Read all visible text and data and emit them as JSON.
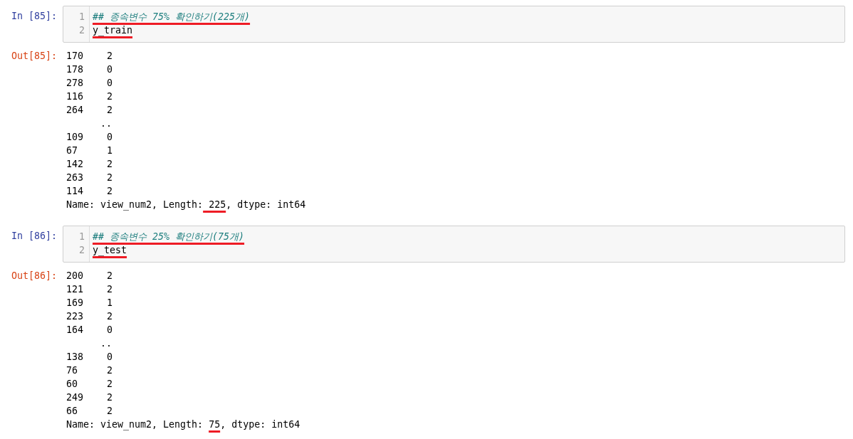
{
  "cells": [
    {
      "prompt_in": "In [85]:",
      "code_lines": [
        {
          "number": "1",
          "kind": "comment",
          "text": "## 종속변수 75% 확인하기(225개)",
          "underlined": true
        },
        {
          "number": "2",
          "kind": "code",
          "text": "y_train",
          "underlined": true
        }
      ],
      "prompt_out": "Out[85]:",
      "output": {
        "rows": [
          {
            "kind": "entry",
            "index": "170",
            "value": "2"
          },
          {
            "kind": "entry",
            "index": "178",
            "value": "0"
          },
          {
            "kind": "entry",
            "index": "278",
            "value": "0"
          },
          {
            "kind": "entry",
            "index": "116",
            "value": "2"
          },
          {
            "kind": "entry",
            "index": "264",
            "value": "2"
          },
          {
            "kind": "ellipsis",
            "value": ".."
          },
          {
            "kind": "entry",
            "index": "109",
            "value": "0"
          },
          {
            "kind": "entry",
            "index": "67",
            "value": "1"
          },
          {
            "kind": "entry",
            "index": "142",
            "value": "2"
          },
          {
            "kind": "entry",
            "index": "263",
            "value": "2"
          },
          {
            "kind": "entry",
            "index": "114",
            "value": "2"
          }
        ],
        "footer": [
          {
            "text": "Name: view_num2, Length:",
            "underlined": false
          },
          {
            "text": " 225",
            "underlined": true
          },
          {
            "text": ", dtype: int64",
            "underlined": false
          }
        ]
      }
    },
    {
      "prompt_in": "In [86]:",
      "code_lines": [
        {
          "number": "1",
          "kind": "comment",
          "text": "## 종속변수 25% 확인하기(75개)",
          "underlined": true
        },
        {
          "number": "2",
          "kind": "code",
          "text": "y_test",
          "underlined": true
        }
      ],
      "prompt_out": "Out[86]:",
      "output": {
        "rows": [
          {
            "kind": "entry",
            "index": "200",
            "value": "2"
          },
          {
            "kind": "entry",
            "index": "121",
            "value": "2"
          },
          {
            "kind": "entry",
            "index": "169",
            "value": "1"
          },
          {
            "kind": "entry",
            "index": "223",
            "value": "2"
          },
          {
            "kind": "entry",
            "index": "164",
            "value": "0"
          },
          {
            "kind": "ellipsis",
            "value": ".."
          },
          {
            "kind": "entry",
            "index": "138",
            "value": "0"
          },
          {
            "kind": "entry",
            "index": "76",
            "value": "2"
          },
          {
            "kind": "entry",
            "index": "60",
            "value": "2"
          },
          {
            "kind": "entry",
            "index": "249",
            "value": "2"
          },
          {
            "kind": "entry",
            "index": "66",
            "value": "2"
          }
        ],
        "footer": [
          {
            "text": "Name: view_num2, Length: ",
            "underlined": false
          },
          {
            "text": "75",
            "underlined": true
          },
          {
            "text": ", dtype: int64",
            "underlined": false
          }
        ]
      }
    }
  ]
}
